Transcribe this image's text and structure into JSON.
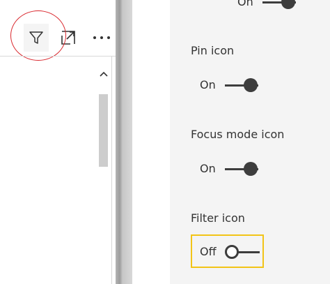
{
  "visual_header": {
    "buttons": [
      {
        "name": "filter-icon",
        "label": "Filter"
      },
      {
        "name": "focus-mode-icon",
        "label": "Focus mode"
      },
      {
        "name": "more-options-icon",
        "label": "More options"
      }
    ],
    "annotation_color": "#d9262c"
  },
  "format_pane": {
    "settings": [
      {
        "label": "",
        "state": "On",
        "is_on": true
      },
      {
        "label": "Pin icon",
        "state": "On",
        "is_on": true
      },
      {
        "label": "Focus mode icon",
        "state": "On",
        "is_on": true
      },
      {
        "label": "Filter icon",
        "state": "Off",
        "is_on": false
      }
    ],
    "highlight_color": "#f2c417"
  }
}
